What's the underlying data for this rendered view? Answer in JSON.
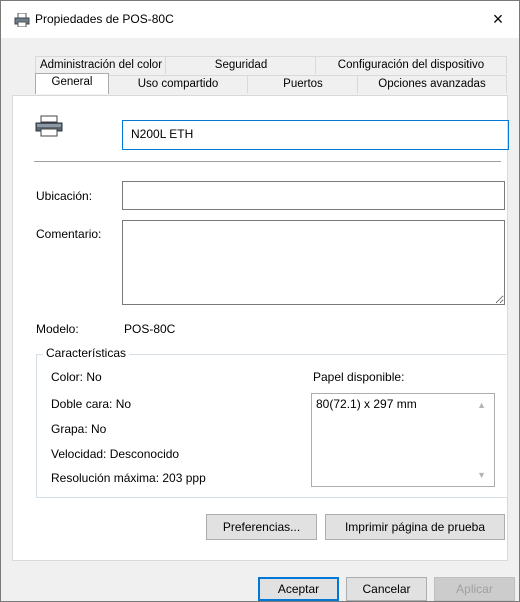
{
  "window": {
    "title": "Propiedades de POS-80C",
    "close": "×"
  },
  "tabs": {
    "row1": [
      "Administración del color",
      "Seguridad",
      "Configuración del dispositivo"
    ],
    "row2": [
      "General",
      "Uso compartido",
      "Puertos",
      "Opciones avanzadas"
    ],
    "active": "General"
  },
  "general": {
    "printer_name": "N200L ETH",
    "location_label": "Ubicación:",
    "location_value": "",
    "comment_label": "Comentario:",
    "comment_value": "",
    "model_label": "Modelo:",
    "model_value": "POS-80C",
    "features_legend": "Características",
    "color": "Color: No",
    "duplex": "Doble cara: No",
    "staple": "Grapa: No",
    "speed": "Velocidad: Desconocido",
    "max_resolution": "Resolución máxima: 203 ppp",
    "paper_label": "Papel disponible:",
    "paper_items": [
      "80(72.1) x 297 mm"
    ],
    "preferences_button": "Preferencias...",
    "test_page_button": "Imprimir página de prueba"
  },
  "footer": {
    "ok": "Aceptar",
    "cancel": "Cancelar",
    "apply": "Aplicar"
  },
  "colors": {
    "accent": "#0078d7",
    "border": "#adadad"
  }
}
